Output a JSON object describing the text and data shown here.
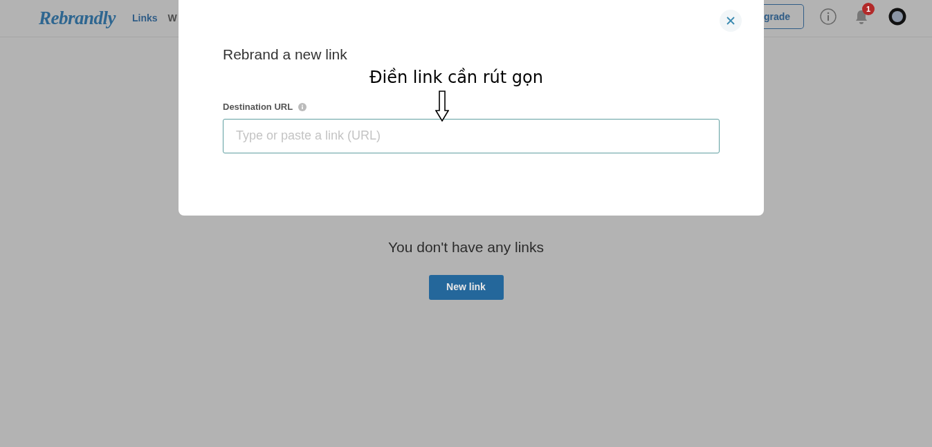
{
  "navbar": {
    "logo": "Rebrandly",
    "nav_items": [
      {
        "label": "Links",
        "selected": true
      },
      {
        "label": "W",
        "selected": false
      }
    ],
    "upgrade_button": "grade",
    "notification_count": "1"
  },
  "empty_state": {
    "message": "You don't have any links",
    "button": "New link"
  },
  "modal": {
    "title": "Rebrand a new link",
    "field_label": "Destination URL",
    "placeholder": "Type or paste a link (URL)"
  },
  "annotation": {
    "text": "Điền link cần rút gọn"
  }
}
